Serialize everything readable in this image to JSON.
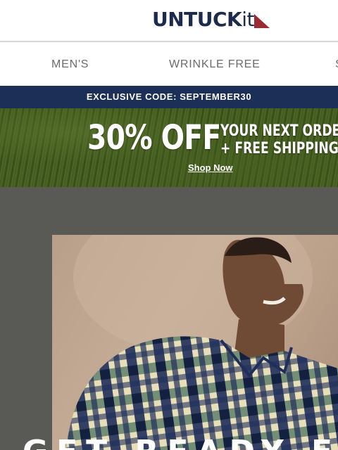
{
  "header": {
    "logo_main": "UNTUCK",
    "logo_suffix": "it"
  },
  "nav": {
    "items": [
      "MEN'S",
      "WRINKLE FREE",
      "S"
    ]
  },
  "promo_bar": {
    "label": "EXCLUSIVE CODE:",
    "code": "SEPTEMBER30"
  },
  "banner": {
    "headline": "30% OFF",
    "line1": "YOUR NEXT ORDER",
    "line2": "+ FREE SHIPPING",
    "cta": "Shop Now"
  },
  "hero": {
    "title": "GET READY FOR F"
  },
  "colors": {
    "navy": "#1c2f57",
    "logo_red": "#9c2a35",
    "hero_bg": "#595a56"
  }
}
